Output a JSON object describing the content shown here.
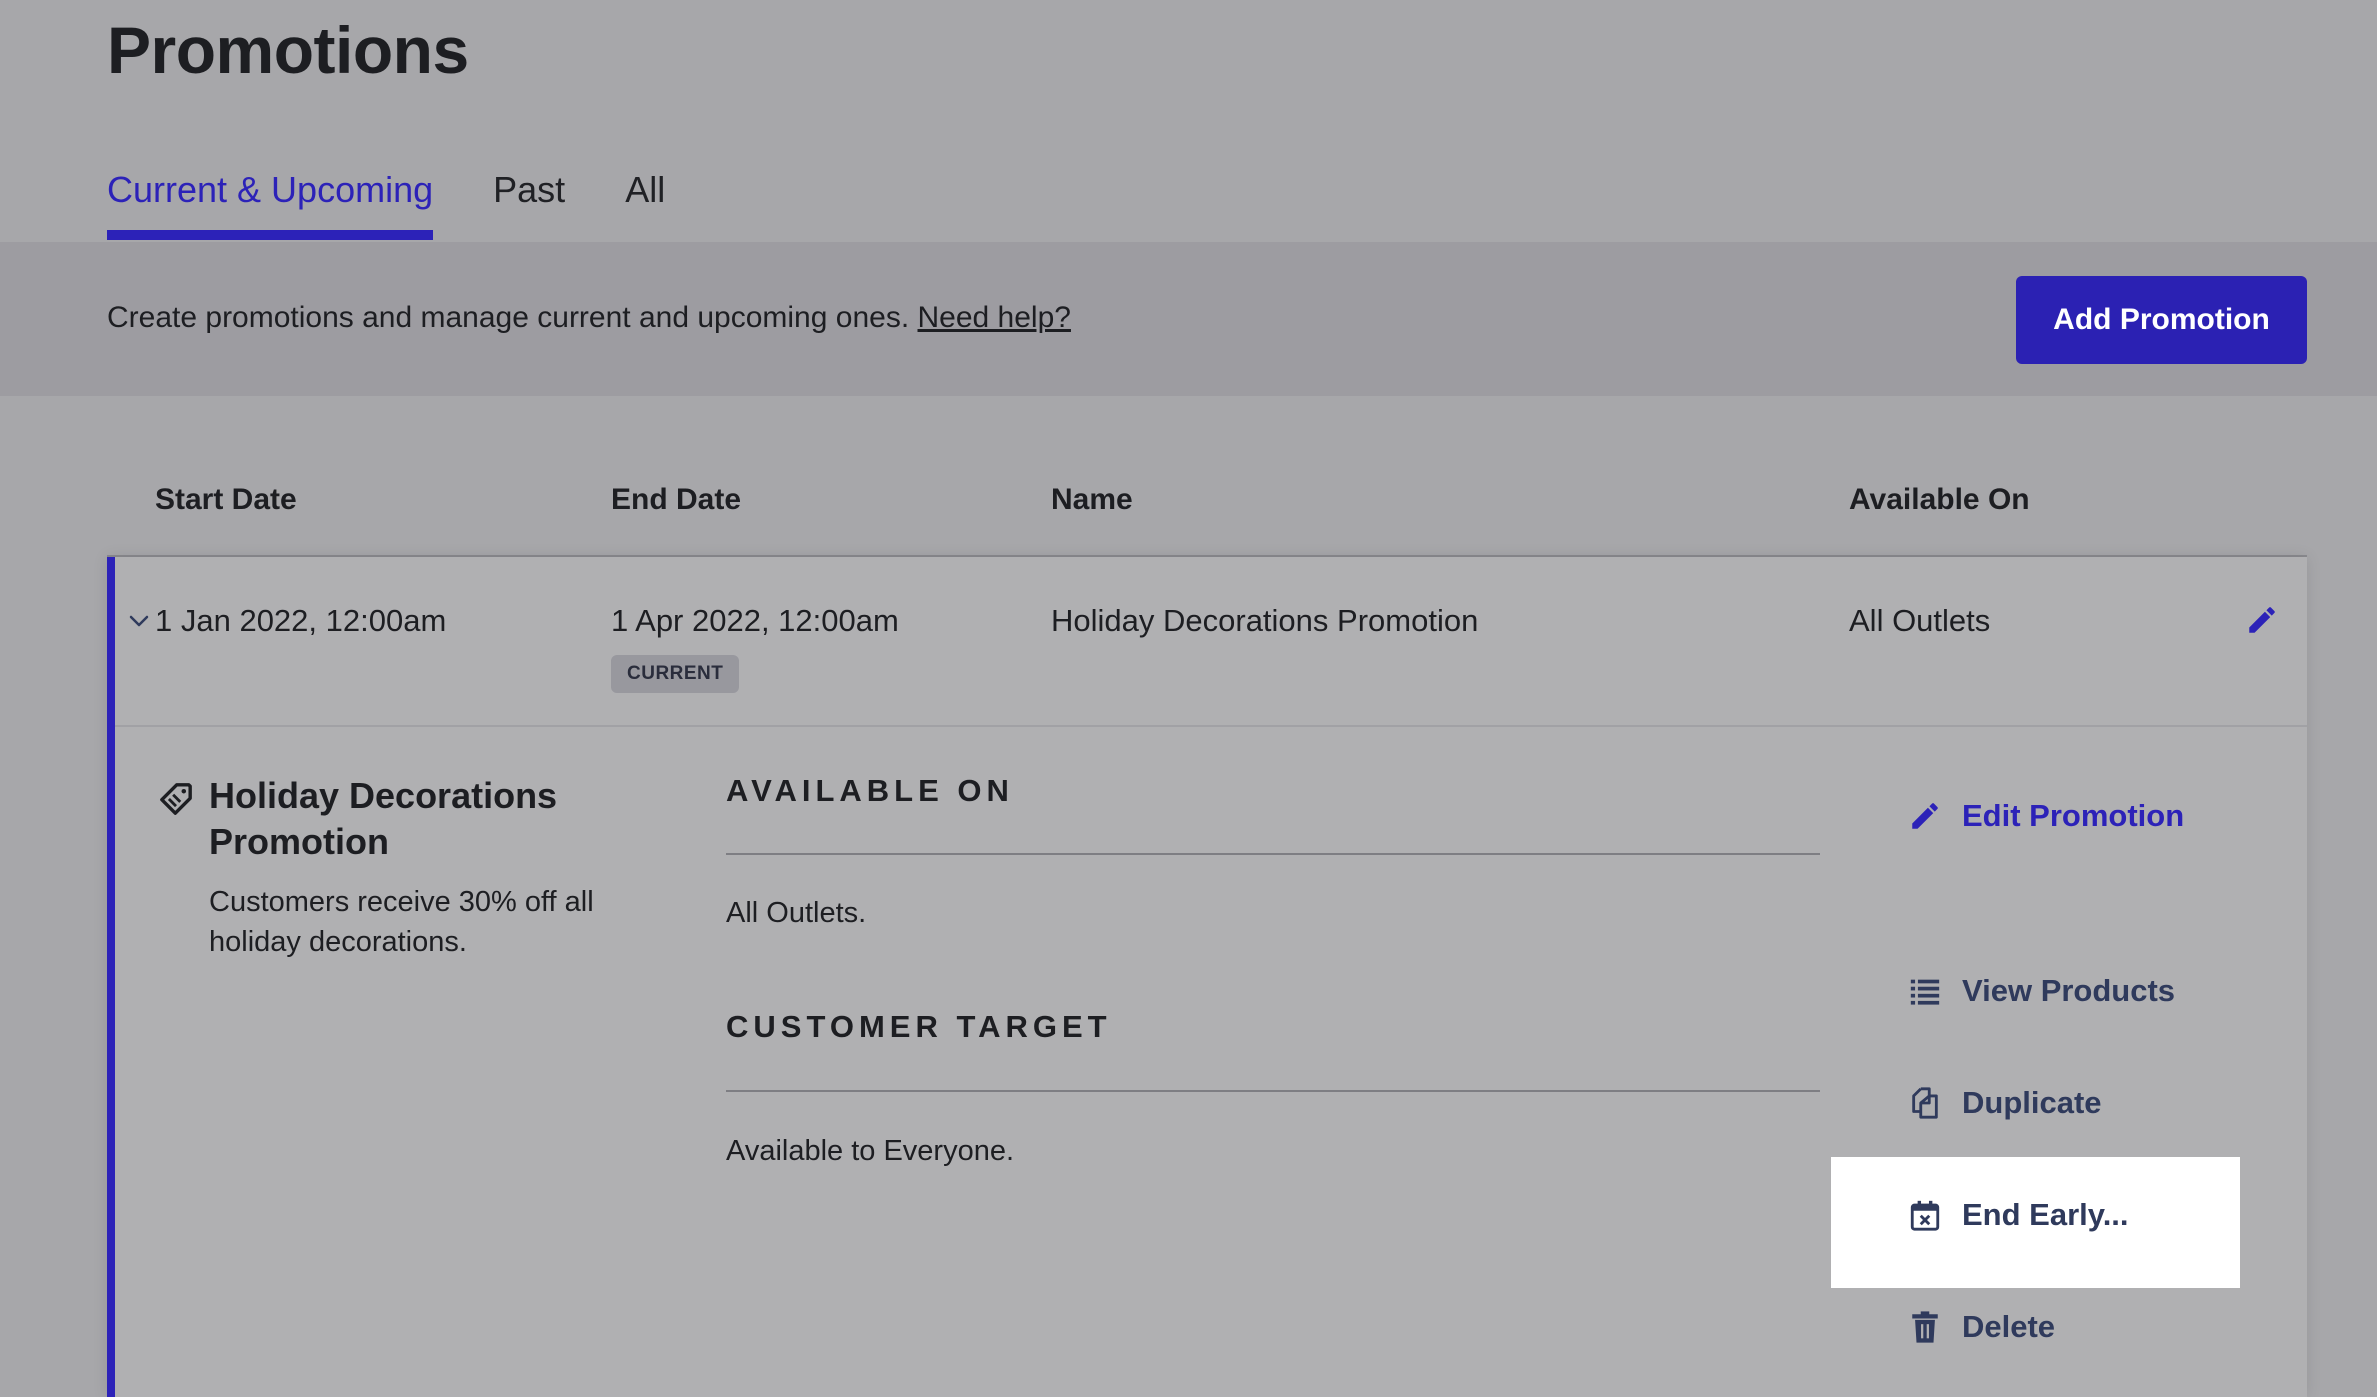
{
  "page": {
    "title": "Promotions"
  },
  "tabs": [
    {
      "label": "Current & Upcoming",
      "active": true
    },
    {
      "label": "Past",
      "active": false
    },
    {
      "label": "All",
      "active": false
    }
  ],
  "info_bar": {
    "text": "Create promotions and manage current and upcoming ones.",
    "help_link": "Need help?",
    "add_button": "Add Promotion"
  },
  "table": {
    "columns": [
      "Start Date",
      "End Date",
      "Name",
      "Available On"
    ],
    "rows": [
      {
        "start_date": "1 Jan 2022, 12:00am",
        "end_date": "1 Apr 2022, 12:00am",
        "status_badge": "CURRENT",
        "name": "Holiday Decorations Promotion",
        "available_on": "All Outlets",
        "expanded": true,
        "details": {
          "title": "Holiday Decorations Promotion",
          "description": "Customers receive 30% off all holiday decorations.",
          "sections": [
            {
              "heading": "AVAILABLE ON",
              "value": "All Outlets."
            },
            {
              "heading": "CUSTOMER TARGET",
              "value": "Available to Everyone."
            }
          ],
          "actions": [
            {
              "label": "Edit Promotion",
              "icon": "pencil-icon"
            },
            {
              "label": "View Products",
              "icon": "list-icon"
            },
            {
              "label": "Duplicate",
              "icon": "duplicate-icon"
            },
            {
              "label": "End Early...",
              "icon": "calendar-x-icon",
              "highlighted": true
            },
            {
              "label": "Delete",
              "icon": "trash-icon"
            }
          ]
        }
      }
    ]
  },
  "colors": {
    "accent": "#2c22b8",
    "background": "#a7a7aa",
    "info_bar": "#9d9ca1",
    "card": "#b0b0b2",
    "action_text": "#2f3a5c"
  }
}
